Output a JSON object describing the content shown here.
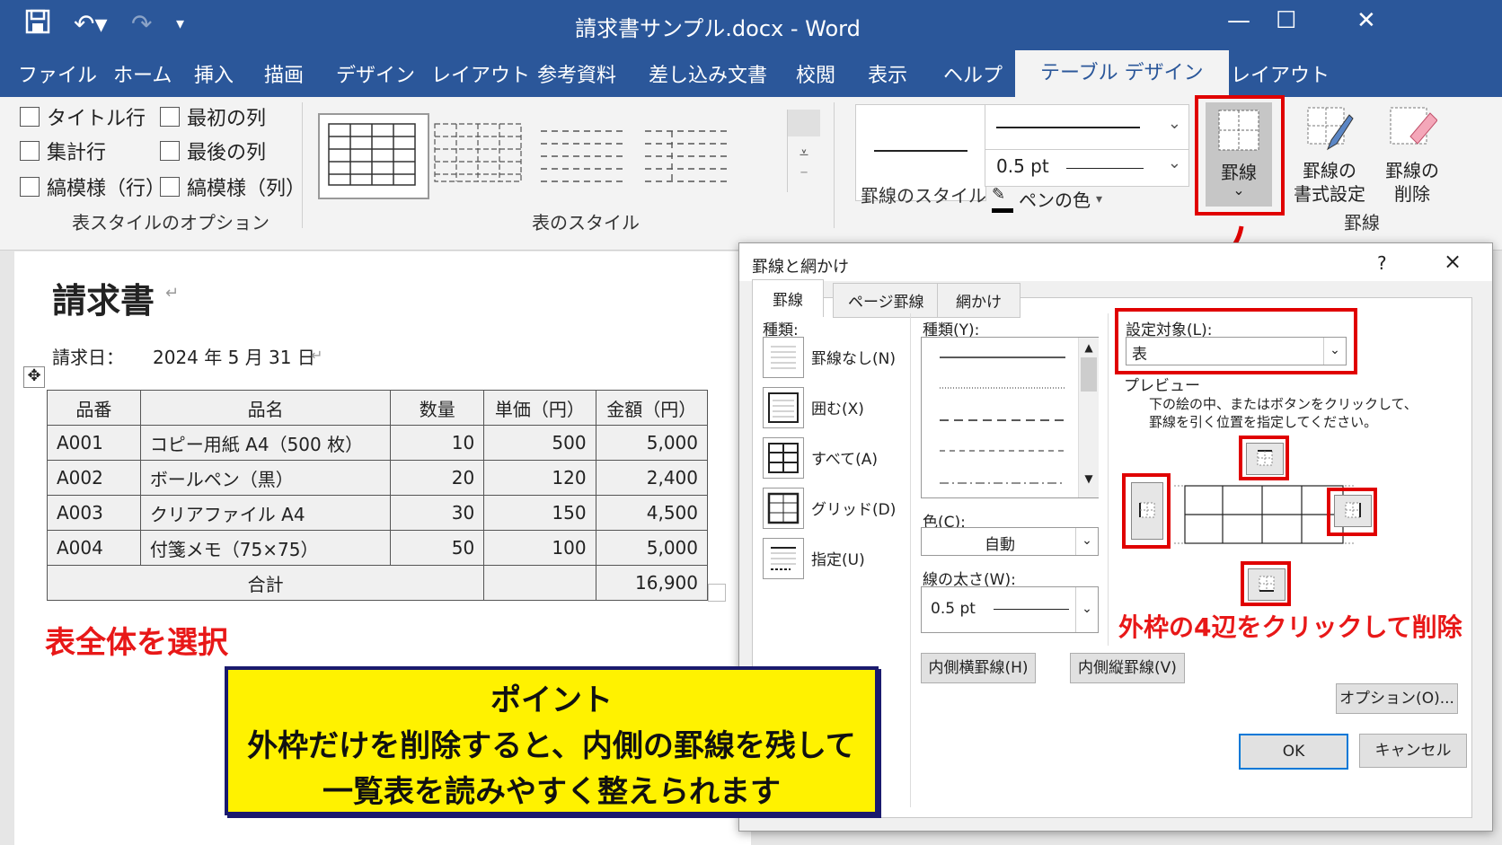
{
  "window": {
    "title": "請求書サンプル.docx  -  Word"
  },
  "tabs": [
    "ファイル",
    "ホーム",
    "挿入",
    "描画",
    "デザイン",
    "レイアウト",
    "参考資料",
    "差し込み文書",
    "校閲",
    "表示",
    "ヘルプ",
    "テーブル デザイン",
    "レイアウト"
  ],
  "ribbon": {
    "options": [
      "タイトル行",
      "最初の列",
      "集計行",
      "最後の列",
      "縞模様（行）",
      "縞模様（列）"
    ],
    "options_group": "表スタイルのオプション",
    "styles_group": "表のスタイル",
    "border_style_label": "罫線のスタイル",
    "pen_weight": "0.5 pt",
    "pen_color": "ペンの色",
    "borders_button": "罫線",
    "border_painter": [
      "罫線の",
      "書式設定"
    ],
    "eraser": [
      "罫線の",
      "削除"
    ],
    "borders_group": "罫線"
  },
  "document": {
    "heading": "請求書",
    "date_label": "請求日：",
    "date_value": "2024 年 5 月 31 日",
    "table": {
      "headers": [
        "品番",
        "品名",
        "数量",
        "単価（円）",
        "金額（円）"
      ],
      "rows": [
        [
          "A001",
          "コピー用紙 A4（500 枚）",
          "10",
          "500",
          "5,000"
        ],
        [
          "A002",
          "ボールペン（黒）",
          "20",
          "120",
          "2,400"
        ],
        [
          "A003",
          "クリアファイル A4",
          "30",
          "150",
          "4,500"
        ],
        [
          "A004",
          "付箋メモ（75×75）",
          "50",
          "100",
          "5,000"
        ]
      ],
      "total_label": "合計",
      "total_value": "16,900"
    }
  },
  "dialog": {
    "title": "罫線と網かけ",
    "help": "?",
    "close": "×",
    "tabs": [
      "罫線",
      "ページ罫線",
      "網かけ"
    ],
    "kind_label": "種類:",
    "settings": [
      "罫線なし(N)",
      "囲む(X)",
      "すべて(A)",
      "グリッド(D)",
      "指定(U)"
    ],
    "style_label": "種類(Y):",
    "color_label": "色(C):",
    "color_value": "自動",
    "width_label": "線の太さ(W):",
    "width_value": "0.5 pt",
    "apply_label": "設定対象(L):",
    "apply_value": "表",
    "preview_label": "プレビュー",
    "preview_hint1": "下の絵の中、またはボタンをクリックして、",
    "preview_hint2": "罫線を引く位置を指定してください。",
    "inner_h": "内側横罫線(H)",
    "inner_v": "内側縦罫線(V)",
    "options": "オプション(O)...",
    "ok": "OK",
    "cancel": "キャンセル"
  },
  "annotations": {
    "select_table": "表全体を選択",
    "click_outer": "外枠の4辺をクリックして削除",
    "point_title": "ポイント",
    "point_line1": "外枠だけを削除すると、内側の罫線を残して",
    "point_line2": "一覧表を読みやすく整えられます"
  },
  "colors": {
    "accent": "#2b579a",
    "highlight": "#e00000",
    "note_bg": "#fff200"
  }
}
